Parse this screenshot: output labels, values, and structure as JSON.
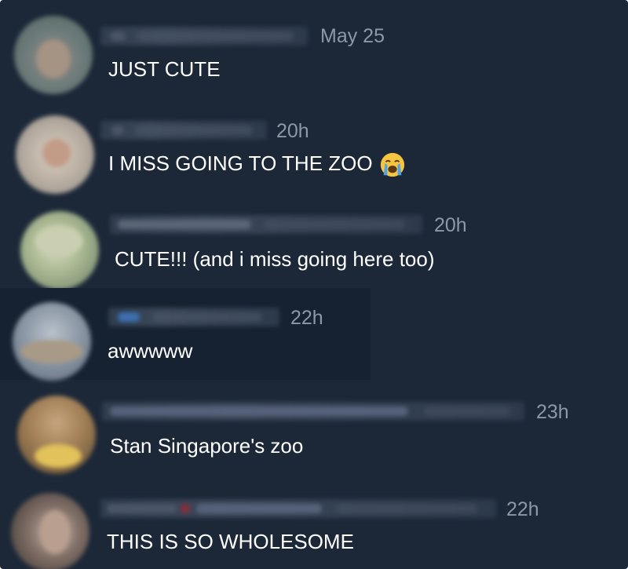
{
  "comments": [
    {
      "timestamp": "May 25",
      "text": "JUST CUTE"
    },
    {
      "timestamp": "20h",
      "text": "I MISS GOING TO THE ZOO",
      "emoji": "loudly-crying-face-icon"
    },
    {
      "timestamp": "20h",
      "text": "CUTE!!! (and i miss going here too)"
    },
    {
      "timestamp": "22h",
      "text": "awwwww"
    },
    {
      "timestamp": "23h",
      "text": "Stan Singapore's zoo"
    },
    {
      "timestamp": "22h",
      "text": "THIS IS SO WHOLESOME"
    }
  ],
  "colors": {
    "background": "#1c2838",
    "highlight": "#162231",
    "timestamp": "#8a98a8",
    "text": "#ffffff"
  }
}
